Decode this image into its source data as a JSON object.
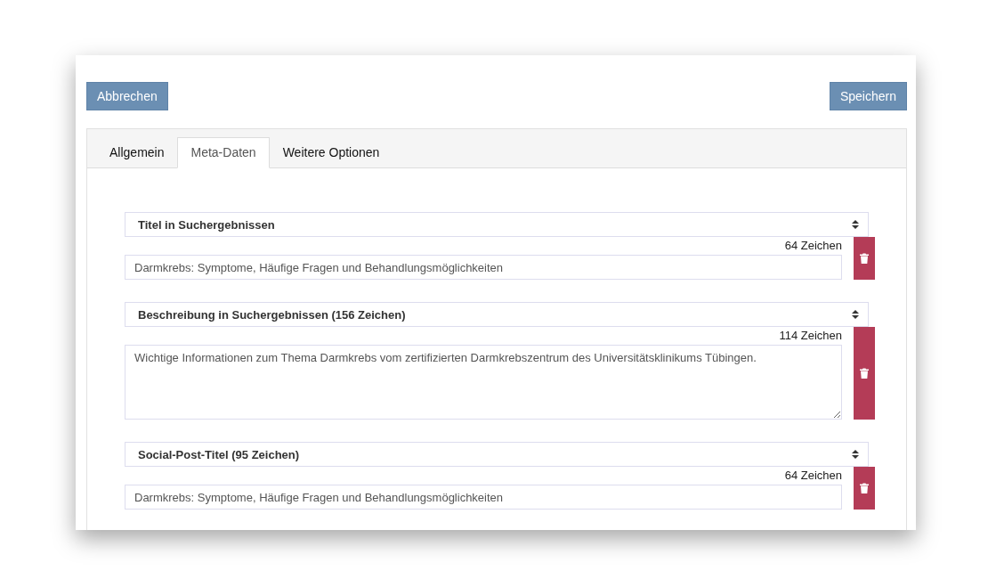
{
  "buttons": {
    "cancel": "Abbrechen",
    "save": "Speichern"
  },
  "tabs": [
    {
      "label": "Allgemein",
      "selected": false
    },
    {
      "label": "Meta-Daten",
      "selected": true
    },
    {
      "label": "Weitere Optionen",
      "selected": false
    }
  ],
  "fields": [
    {
      "kind": "input",
      "select": "Titel in Suchergebnissen",
      "count": "64 Zeichen",
      "value": "Darmkrebs: Symptome, Häufige Fragen und Behandlungsmöglichkeiten"
    },
    {
      "kind": "textarea",
      "select": "Beschreibung in Suchergebnissen (156 Zeichen)",
      "count": "114 Zeichen",
      "value": "Wichtige Informationen zum Thema Darmkrebs vom zertifizierten Darmkrebszentrum des Universitätsklinikums Tübingen."
    },
    {
      "kind": "input",
      "select": "Social-Post-Titel (95 Zeichen)",
      "count": "64 Zeichen",
      "value": "Darmkrebs: Symptome, Häufige Fragen und Behandlungsmöglichkeiten"
    }
  ]
}
